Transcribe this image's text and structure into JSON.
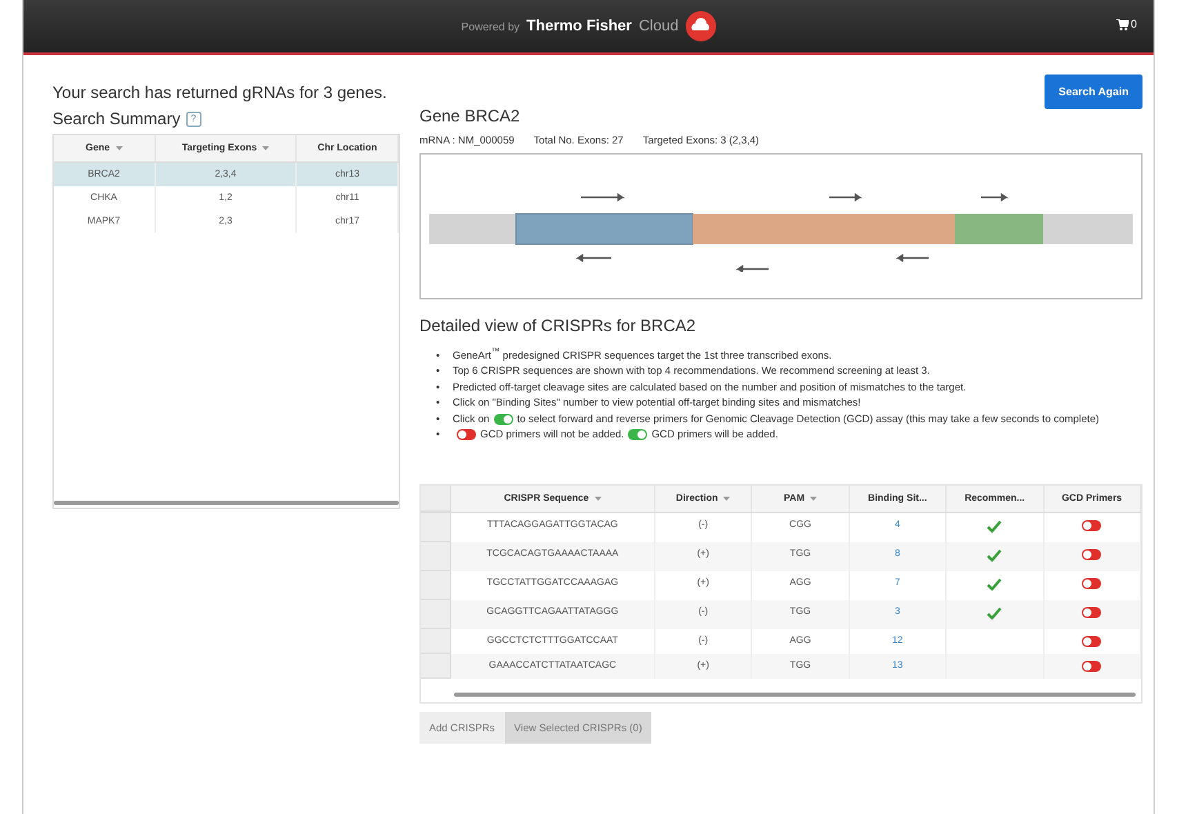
{
  "topbar": {
    "powered": "Powered by",
    "brand": "Thermo Fisher",
    "cloud": "Cloud",
    "cart_count": "0"
  },
  "headline": "Your search has returned gRNAs for 3 genes.",
  "search_again": "Search Again",
  "summary": {
    "title": "Search Summary",
    "help": "?",
    "columns": [
      "Gene",
      "Targeting Exons",
      "Chr Location"
    ],
    "rows": [
      {
        "gene": "BRCA2",
        "exons": "2,3,4",
        "chr": "chr13",
        "selected": true
      },
      {
        "gene": "CHKA",
        "exons": "1,2",
        "chr": "chr11",
        "selected": false
      },
      {
        "gene": "MAPK7",
        "exons": "2,3",
        "chr": "chr17",
        "selected": false
      }
    ]
  },
  "gene": {
    "title": "Gene BRCA2",
    "mrna": "mRNA : NM_000059",
    "total": "Total No. Exons: 27",
    "targeted": "Targeted Exons: 3 (2,3,4)"
  },
  "detail_title": "Detailed view of CRISPRs for BRCA2",
  "bullet_marker": "•",
  "bullets": [
    {
      "kind": "text",
      "text": "GeneArt$^{™}$ predesigned CRISPR sequences target the 1st three transcribed exons."
    },
    {
      "kind": "text",
      "text": "Top 6 CRISPR sequences are shown with top 4 recommendations. We recommend screening at least 3."
    },
    {
      "kind": "text",
      "text": "Predicted off-target cleavage sites are calculated based on the number and position of mismatches to the target."
    },
    {
      "kind": "text",
      "text": "Click on \"Binding Sites\" number to view potential off-target binding sites and mismatches!"
    },
    {
      "kind": "inline-toggle",
      "before": "Click on",
      "on": true,
      "after": "to select forward and reverse primers for Genomic Cleavage Detection (GCD) assay (this may take a few seconds to complete)"
    },
    {
      "kind": "legend",
      "items": [
        {
          "on": false,
          "text": "GCD primers will not be added."
        },
        {
          "on": true,
          "text": "GCD primers will be added."
        }
      ]
    }
  ],
  "crisprs": {
    "columns": [
      "CRISPR Sequence",
      "Direction",
      "PAM",
      "Binding Sit...",
      "Recommen...",
      "GCD Primers"
    ],
    "rows": [
      {
        "sequence": "TTTACAGGAGATTGGTACAG",
        "direction": "(-)",
        "pam": "CGG",
        "sites": "4",
        "recommended": true,
        "gcd": false
      },
      {
        "sequence": "TCGCACAGTGAAAACTAAAA",
        "direction": "(+)",
        "pam": "TGG",
        "sites": "8",
        "recommended": true,
        "gcd": false
      },
      {
        "sequence": "TGCCTATTGGATCCAAAGAG",
        "direction": "(+)",
        "pam": "AGG",
        "sites": "7",
        "recommended": true,
        "gcd": false
      },
      {
        "sequence": "GCAGGTTCAGAATTATAGGG",
        "direction": "(-)",
        "pam": "TGG",
        "sites": "3",
        "recommended": true,
        "gcd": false
      },
      {
        "sequence": "GGCCTCTCTTTGGATCCAAT",
        "direction": "(-)",
        "pam": "AGG",
        "sites": "12",
        "recommended": false,
        "gcd": false
      },
      {
        "sequence": "GAAACCATCTTATAATCAGC",
        "direction": "(+)",
        "pam": "TGG",
        "sites": "13",
        "recommended": false,
        "gcd": false
      }
    ]
  },
  "buttons": [
    "Add CRISPRs",
    "View Selected CRISPRs (0)"
  ]
}
